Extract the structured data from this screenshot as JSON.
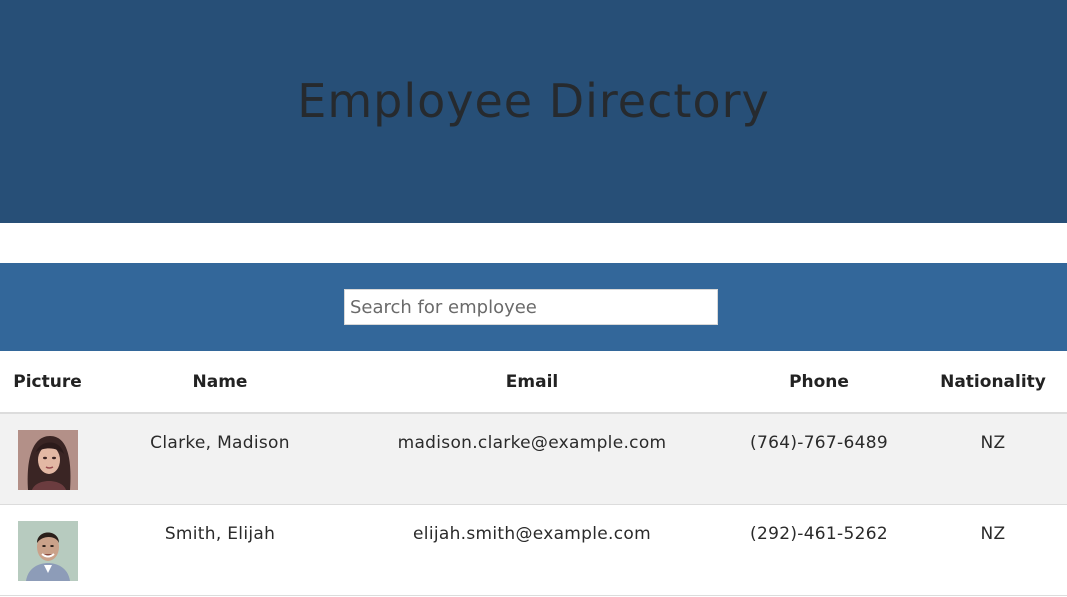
{
  "header": {
    "title": "Employee Directory"
  },
  "search": {
    "placeholder": "Search for employee",
    "value": ""
  },
  "table": {
    "columns": [
      "Picture",
      "Name",
      "Email",
      "Phone",
      "Nationality"
    ],
    "rows": [
      {
        "picture": "portrait-woman-dark-hair",
        "name": "Clarke, Madison",
        "email": "madison.clarke@example.com",
        "phone": "(764)-767-6489",
        "nationality": "NZ"
      },
      {
        "picture": "portrait-man-smiling",
        "name": "Smith, Elijah",
        "email": "elijah.smith@example.com",
        "phone": "(292)-461-5262",
        "nationality": "NZ"
      }
    ]
  },
  "colors": {
    "header_bg": "#274f77",
    "search_bar_bg": "#33679a",
    "row_alt_bg": "#f2f2f2"
  }
}
